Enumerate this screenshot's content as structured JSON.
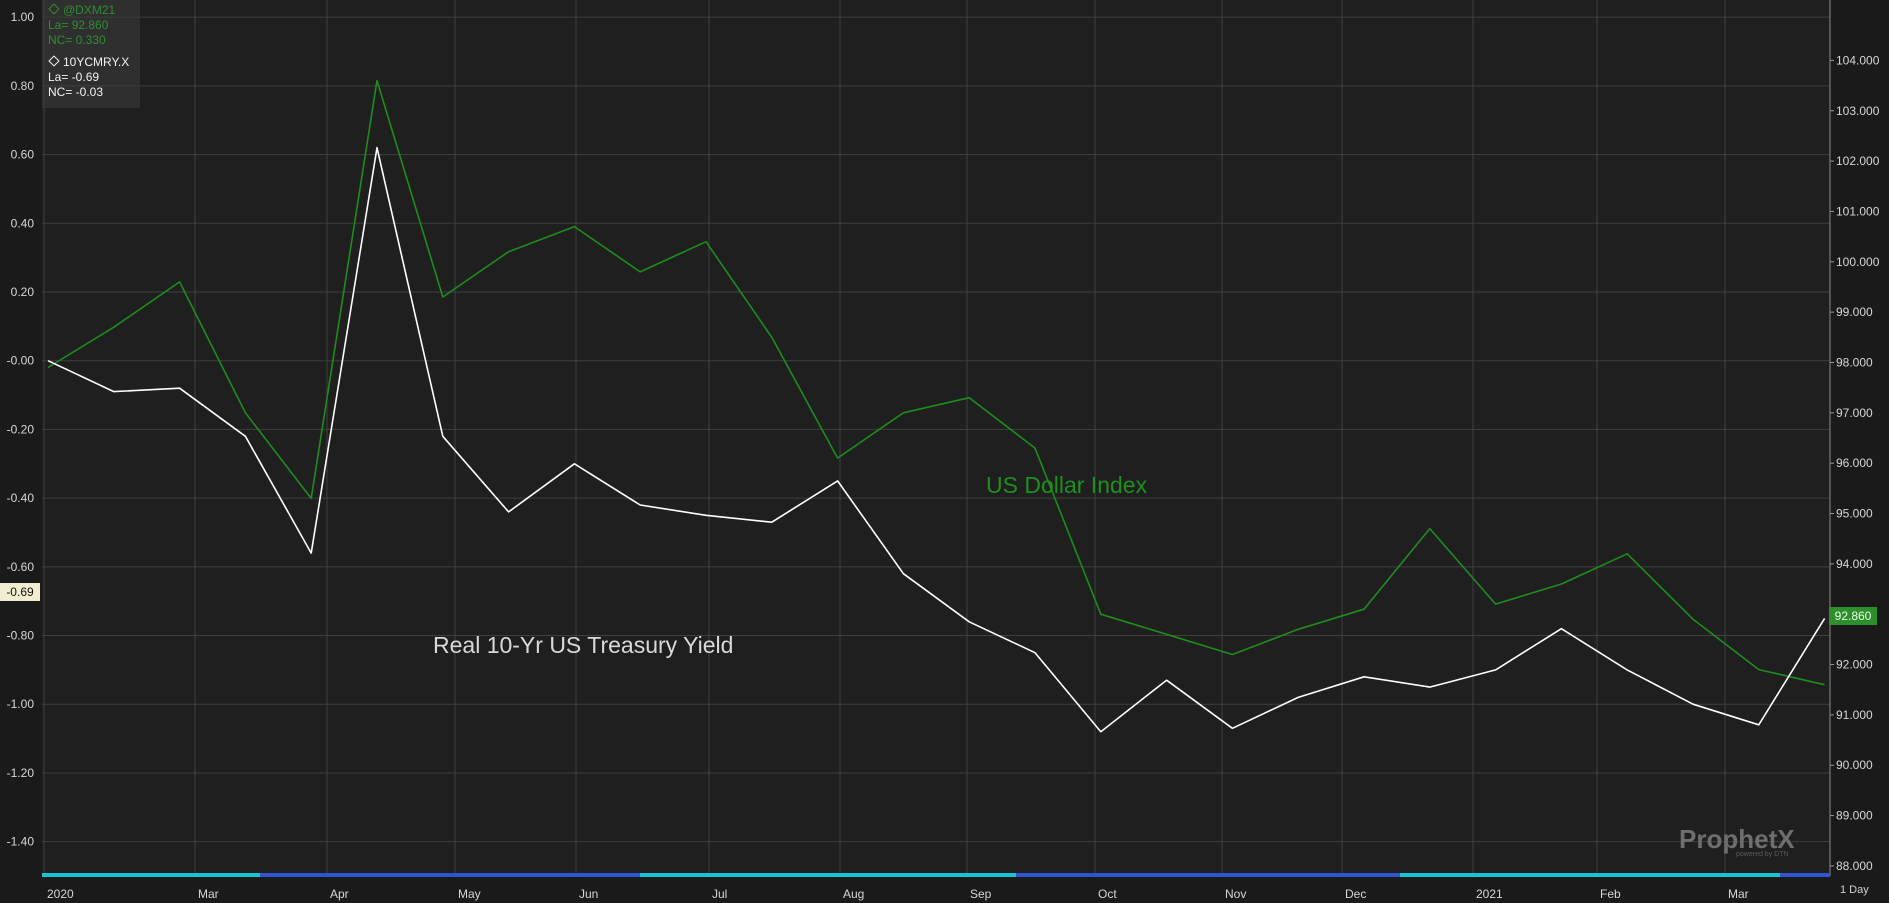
{
  "legend": {
    "dxm_symbol": "@DXM21",
    "dxm_last": "La= 92.860",
    "dxm_change": "NC= 0.330",
    "yld_symbol": "10YCMRY.X",
    "yld_last": "La= -0.69",
    "yld_change": "NC= -0.03"
  },
  "tags": {
    "left_value": "-0.69",
    "right_value": "92.860"
  },
  "period": "1 Day",
  "watermark": {
    "brand": "ProphetX",
    "sub": "powered by DTN"
  },
  "colors": {
    "background": "#1a1a1a",
    "grid": "#3f3f3f",
    "dollar_index": "#1e8c1e",
    "yield": "#ffffff",
    "timebar_cyan": "#17c4cf",
    "timebar_blue": "#2f55d4"
  },
  "chart_data": {
    "type": "line",
    "title": "",
    "grid": true,
    "x_tick_labels": [
      "2020",
      "Mar",
      "Apr",
      "May",
      "Jun",
      "Jul",
      "Aug",
      "Sep",
      "Oct",
      "Nov",
      "Dec",
      "2021",
      "Feb",
      "Mar"
    ],
    "left_axis": {
      "ylim": [
        -1.5,
        1.05
      ],
      "ticks": [
        "1.00",
        "0.80",
        "0.60",
        "0.40",
        "0.20",
        "-0.00",
        "-0.20",
        "-0.40",
        "-0.60",
        "-0.80",
        "-1.00",
        "-1.20",
        "-1.40"
      ]
    },
    "right_axis": {
      "ylim": [
        87.8,
        105.2
      ],
      "ticks": [
        "88.000",
        "89.000",
        "90.000",
        "91.000",
        "92.000",
        "93.000",
        "94.000",
        "95.000",
        "96.000",
        "97.000",
        "98.000",
        "99.000",
        "100.000",
        "101.000",
        "102.000",
        "103.000",
        "104.000"
      ]
    },
    "series": [
      {
        "name": "US Dollar Index",
        "axis": "right",
        "color": "#1e8c1e",
        "x": [
          0,
          0.5,
          1,
          1.5,
          2,
          2.5,
          3,
          3.5,
          4,
          4.5,
          5,
          5.5,
          6,
          6.5,
          7,
          7.5,
          8,
          8.5,
          9,
          9.5,
          10,
          10.5,
          11,
          11.5,
          12,
          12.5,
          13,
          13.5
        ],
        "y": [
          97.9,
          98.7,
          99.6,
          97.0,
          95.3,
          103.6,
          99.3,
          100.2,
          100.7,
          99.8,
          100.4,
          98.5,
          96.1,
          97.0,
          97.3,
          96.3,
          93.0,
          92.6,
          92.2,
          92.7,
          93.1,
          94.7,
          93.2,
          93.6,
          94.2,
          92.9,
          91.9,
          91.6
        ]
      },
      {
        "name": "Real 10-Yr US Treasury Yield",
        "axis": "left",
        "color": "#ffffff",
        "x": [
          0,
          0.5,
          1,
          1.5,
          2,
          2.5,
          3,
          3.5,
          4,
          4.5,
          5,
          5.5,
          6,
          6.5,
          7,
          7.5,
          8,
          8.5,
          9,
          9.5,
          10,
          10.5,
          11,
          11.5,
          12,
          12.5,
          13,
          13.5
        ],
        "y": [
          0.0,
          -0.09,
          -0.08,
          -0.22,
          -0.56,
          0.62,
          -0.22,
          -0.44,
          -0.3,
          -0.42,
          -0.45,
          -0.47,
          -0.35,
          -0.62,
          -0.76,
          -0.85,
          -1.08,
          -0.93,
          -1.07,
          -0.98,
          -0.92,
          -0.95,
          -0.9,
          -0.78,
          -0.9,
          -1.0,
          -1.06,
          -0.75
        ]
      }
    ]
  }
}
